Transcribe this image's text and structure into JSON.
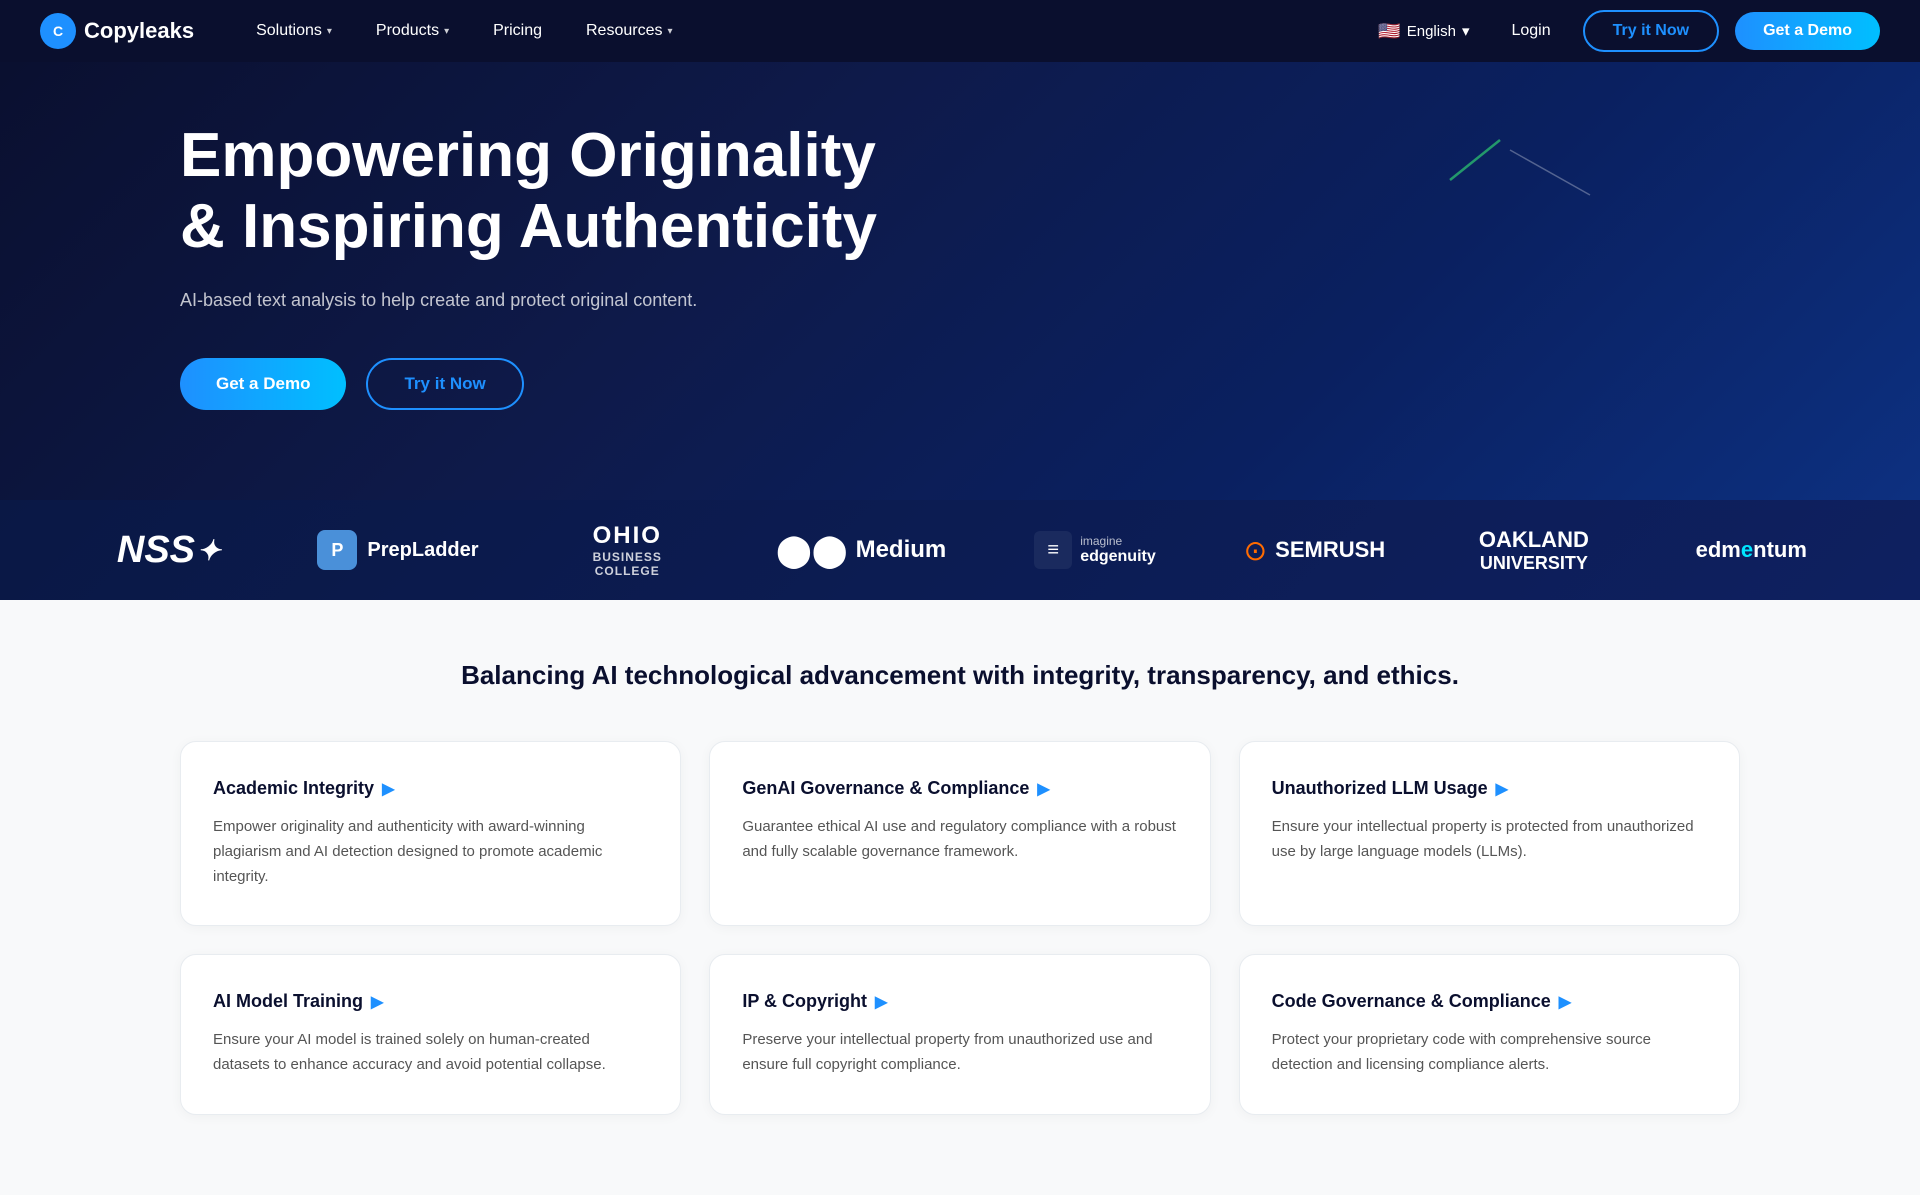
{
  "navbar": {
    "logo_letter": "C",
    "logo_name": "Copyleaks",
    "nav_items": [
      {
        "label": "Solutions",
        "has_arrow": true
      },
      {
        "label": "Products",
        "has_arrow": true
      },
      {
        "label": "Pricing",
        "has_arrow": false
      },
      {
        "label": "Resources",
        "has_arrow": true
      }
    ],
    "lang_flag": "🇺🇸",
    "lang_label": "English",
    "login_label": "Login",
    "try_label": "Try it Now",
    "demo_label": "Get a Demo"
  },
  "hero": {
    "title_line1": "Empowering Originality",
    "title_line2": "& Inspiring Authenticity",
    "subtitle": "AI-based text analysis to help create and protect original content.",
    "demo_btn": "Get a Demo",
    "try_btn": "Try it Now"
  },
  "logos": [
    {
      "id": "nss",
      "type": "nss",
      "text": "NSS"
    },
    {
      "id": "prepladder",
      "type": "prepladder",
      "icon": "P",
      "text": "PrepLadder"
    },
    {
      "id": "ohio",
      "type": "ohio",
      "line1": "OHIO",
      "line2": "BUSINESS COLLEGE"
    },
    {
      "id": "medium",
      "type": "medium",
      "text": "Medium"
    },
    {
      "id": "edgenuity",
      "type": "edgenuity",
      "icon": "≡",
      "line1": "imagine",
      "line2": "edgenuity"
    },
    {
      "id": "semrush",
      "type": "semrush",
      "icon": "⊙",
      "text": "SEMRUSH"
    },
    {
      "id": "oakland",
      "type": "text",
      "line1": "OAKLAND",
      "line2": "UNIVERSITY"
    },
    {
      "id": "edmentum",
      "type": "text",
      "text": "edmentum"
    }
  ],
  "features": {
    "section_title": "Balancing AI technological advancement with integrity, transparency, and ethics.",
    "cards": [
      {
        "title": "Academic Integrity",
        "description": "Empower originality and authenticity with award-winning plagiarism and AI detection designed to promote academic integrity."
      },
      {
        "title": "GenAI Governance & Compliance",
        "description": "Guarantee ethical AI use and regulatory compliance with a robust and fully scalable governance framework."
      },
      {
        "title": "Unauthorized LLM Usage",
        "description": "Ensure your intellectual property is protected from unauthorized use by large language models (LLMs)."
      },
      {
        "title": "AI Model Training",
        "description": "Ensure your AI model is trained solely on human-created datasets to enhance accuracy and avoid potential collapse."
      },
      {
        "title": "IP & Copyright",
        "description": "Preserve your intellectual property from unauthorized use and ensure full copyright compliance."
      },
      {
        "title": "Code Governance & Compliance",
        "description": "Protect your proprietary code with comprehensive source detection and licensing compliance alerts."
      }
    ]
  }
}
